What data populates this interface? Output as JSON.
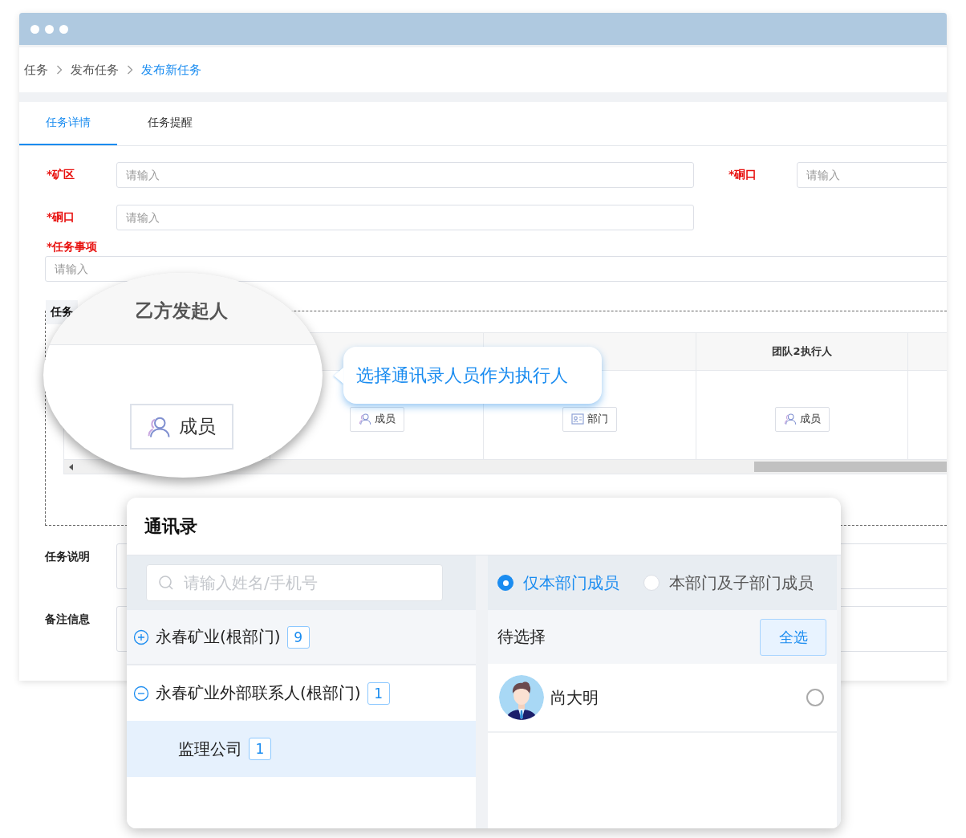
{
  "breadcrumb": [
    {
      "label": "任务",
      "current": false
    },
    {
      "label": "发布任务",
      "current": false
    },
    {
      "label": "发布新任务",
      "current": true
    }
  ],
  "tabs": [
    {
      "label": "任务详情",
      "selected": true
    },
    {
      "label": "任务提醒",
      "selected": false
    }
  ],
  "form_rows": [
    {
      "kind": "inline",
      "fields": [
        {
          "label": "*矿区",
          "placeholder": "请输入"
        },
        {
          "label": "*硐口",
          "placeholder": "请输入"
        }
      ]
    },
    {
      "kind": "inline",
      "fields": [
        {
          "label": "*硐口",
          "placeholder": "请输入"
        }
      ]
    },
    {
      "kind": "stacked",
      "fields": [
        {
          "label": "*任务事项",
          "placeholder": "请输入"
        }
      ]
    }
  ],
  "section": {
    "tag": "任务",
    "columns": [
      {
        "button": {
          "kind": "member",
          "label": "成员"
        }
      },
      {
        "button": {
          "kind": "department",
          "label": "部门"
        }
      },
      {
        "header": "团队2执行人",
        "button": {
          "kind": "member",
          "label": "成员"
        }
      }
    ]
  },
  "notes": [
    {
      "label": "任务说明"
    },
    {
      "label": "备注信息"
    }
  ],
  "magnifier": {
    "header": "乙方发起人",
    "button": {
      "kind": "member",
      "label": "成员"
    }
  },
  "tooltip": {
    "text": "选择通讯录人员作为执行人"
  },
  "contacts_dialog": {
    "title": "通讯录",
    "search": {
      "placeholder": "请输入姓名/手机号"
    },
    "tree": [
      {
        "label": "永春矿业(根部门)",
        "count": "9",
        "expanded": false,
        "selected": false
      },
      {
        "label": "永春矿业外部联系人(根部门)",
        "count": "1",
        "expanded": true,
        "selected": false,
        "children": [
          {
            "label": "监理公司",
            "count": "1",
            "selected": true
          }
        ]
      }
    ],
    "scope": [
      {
        "label": "仅本部门成员",
        "selected": true
      },
      {
        "label": "本部门及子部门成员",
        "selected": false
      }
    ],
    "pending_label": "待选择",
    "select_all": "全选",
    "members": [
      {
        "name": "尚大明",
        "checked": false
      }
    ]
  }
}
